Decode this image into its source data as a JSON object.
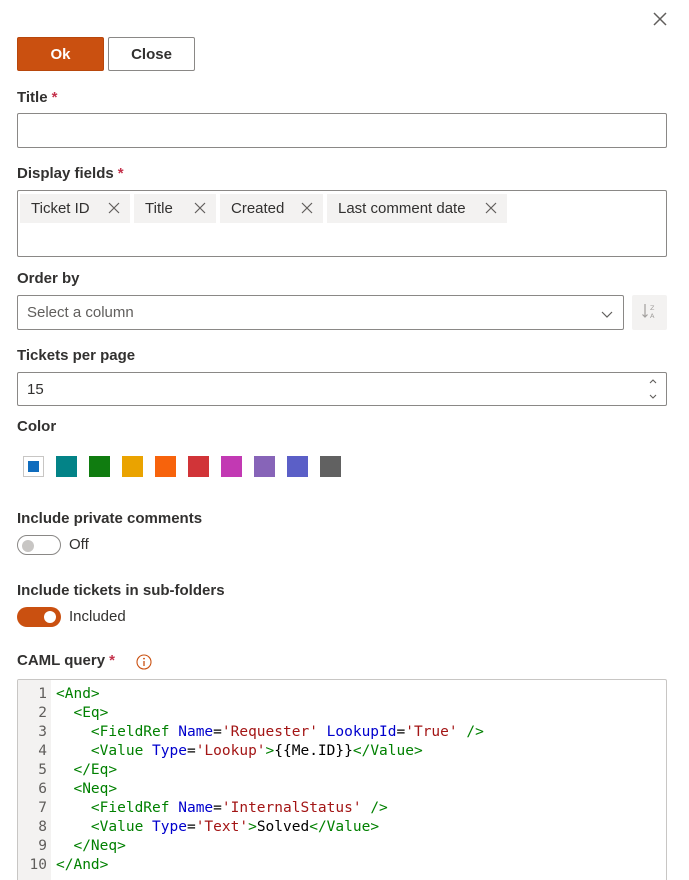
{
  "dialog": {
    "ok_label": "Ok",
    "close_label": "Close"
  },
  "fields": {
    "title_label": "Title",
    "title_value": "",
    "display_fields_label": "Display fields",
    "display_fields": [
      "Ticket ID",
      "Title",
      "Created",
      "Last comment date"
    ],
    "order_by_label": "Order by",
    "order_by_placeholder": "Select a column",
    "tickets_per_page_label": "Tickets per page",
    "tickets_per_page_value": "15",
    "color_label": "Color",
    "colors": [
      "#0f6cbd",
      "#038387",
      "#107c10",
      "#eaa300",
      "#f7630c",
      "#d13438",
      "#c239b3",
      "#8764b8",
      "#5b5fc7",
      "#616161"
    ],
    "selected_color": "#0f6cbd",
    "private_comments_label": "Include private comments",
    "private_comments_state": "Off",
    "subfolders_label": "Include tickets in sub-folders",
    "subfolders_state": "Included",
    "caml_label": "CAML query",
    "required_mark": "*"
  },
  "icons": {
    "close": "close-icon",
    "remove_tag": "close-icon",
    "chevron": "chevron-down-icon",
    "sort": "sort-az-icon",
    "info": "info-icon"
  },
  "caml": {
    "line_numbers": [
      "1",
      "2",
      "3",
      "4",
      "5",
      "6",
      "7",
      "8",
      "9",
      "10"
    ],
    "lines": [
      "<And>",
      "  <Eq>",
      "    <FieldRef Name='Requester' LookupId='True' />",
      "    <Value Type='Lookup'>{{Me.ID}}</Value>",
      "  </Eq>",
      "  <Neq>",
      "    <FieldRef Name='InternalStatus' />",
      "    <Value Type='Text'>Solved</Value>",
      "  </Neq>",
      "</And>"
    ]
  },
  "theme": {
    "accent": "#ca5010",
    "required": "#c4314b"
  }
}
